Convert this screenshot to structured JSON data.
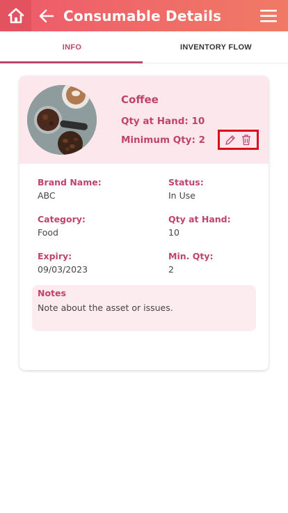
{
  "header": {
    "title": "Consumable Details",
    "home_icon": "home-icon",
    "back_icon": "arrow-left-icon",
    "menu_icon": "hamburger-menu-icon",
    "color_start": "#ee5a6a",
    "color_end": "#f07a66"
  },
  "tabs": [
    {
      "label": "INFO",
      "active": true
    },
    {
      "label": "INVENTORY FLOW",
      "active": false
    }
  ],
  "item": {
    "name": "Coffee",
    "qty_at_hand_line": "Qty at Hand: 10",
    "min_qty_line": "Minimum Qty: 2",
    "image": "coffee-photo",
    "actions": {
      "edit_icon": "pencil-icon",
      "delete_icon": "trash-icon"
    }
  },
  "details": {
    "brand": {
      "label": "Brand Name:",
      "value": "ABC"
    },
    "status": {
      "label": "Status:",
      "value": "In Use"
    },
    "category": {
      "label": "Category:",
      "value": "Food"
    },
    "qty_hand": {
      "label": "Qty at Hand:",
      "value": "10"
    },
    "expiry": {
      "label": "Expiry:",
      "value": "09/03/2023"
    },
    "min_qty": {
      "label": "Min. Qty:",
      "value": "2"
    }
  },
  "notes": {
    "label": "Notes",
    "text": "Note about the asset or issues."
  },
  "colors": {
    "accent": "#c0436c",
    "highlight_border": "#d7101c",
    "card_top_bg": "#fce8ec"
  }
}
